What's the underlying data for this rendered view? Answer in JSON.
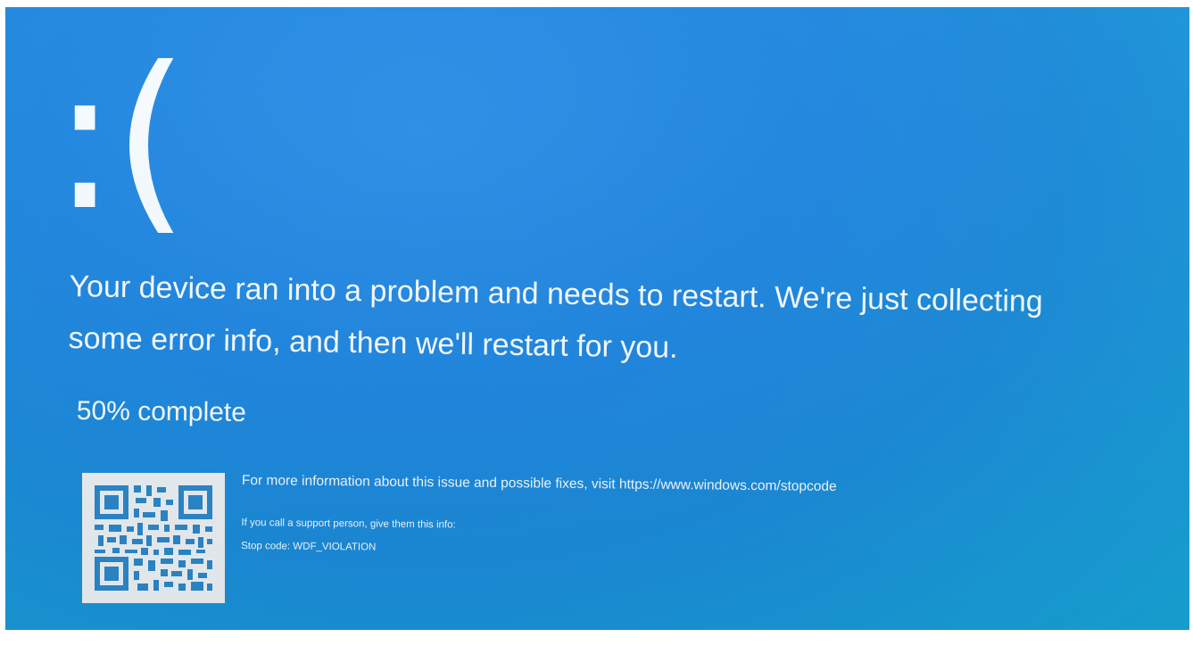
{
  "bsod": {
    "sad_face": ":(",
    "message": "Your device ran into a problem and needs to restart. We're just collecting some error info, and then we'll restart for you.",
    "progress_text": "50% complete",
    "progress_percent": 50,
    "more_info": "For more information about this issue and possible fixes, visit https://www.windows.com/stopcode",
    "support_prompt": "If you call a support person, give them this info:",
    "stop_code": "Stop code: WDF_VIOLATION"
  },
  "colors": {
    "background": "#1f86e0",
    "text": "#ffffff"
  },
  "icons": {
    "qr": "qr-code-icon"
  }
}
